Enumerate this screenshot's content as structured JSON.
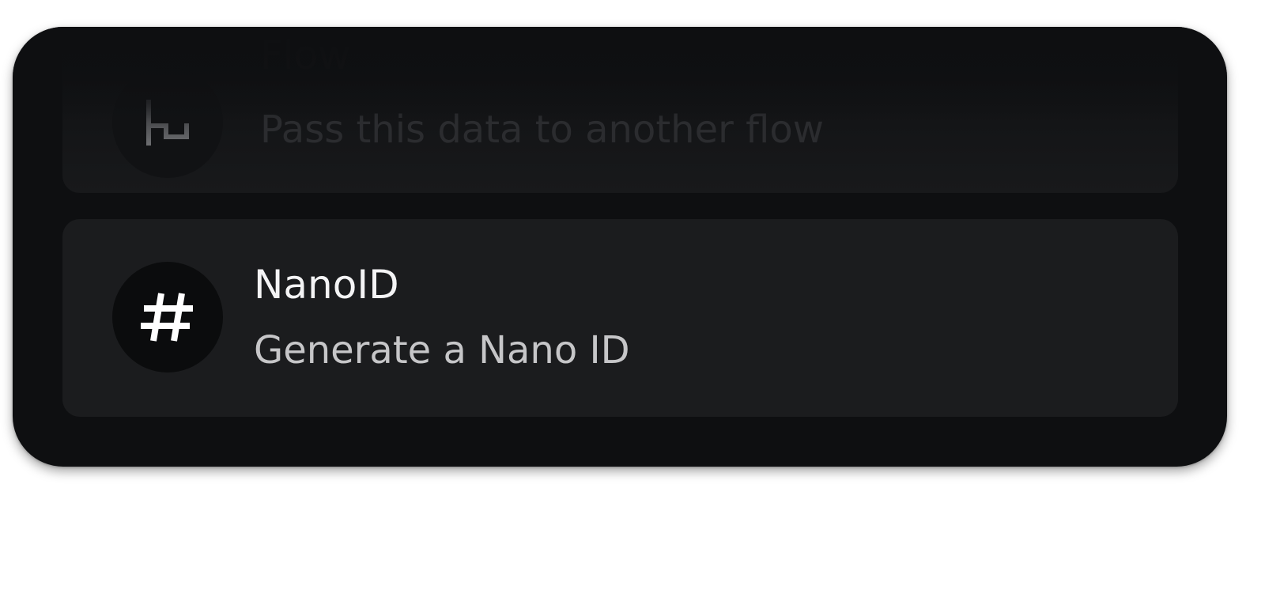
{
  "items": [
    {
      "title": "Flow",
      "description": "Pass this data to another flow",
      "icon": "flow-icon"
    },
    {
      "title": "NanoID",
      "description": "Generate a Nano ID",
      "icon": "hash-icon"
    }
  ],
  "colors": {
    "panel_background": "#0e0f11",
    "card_background": "#1b1c1e",
    "icon_background": "#0b0c0d",
    "title_text": "#f4f4f5",
    "description_text": "#c6c6c8"
  }
}
